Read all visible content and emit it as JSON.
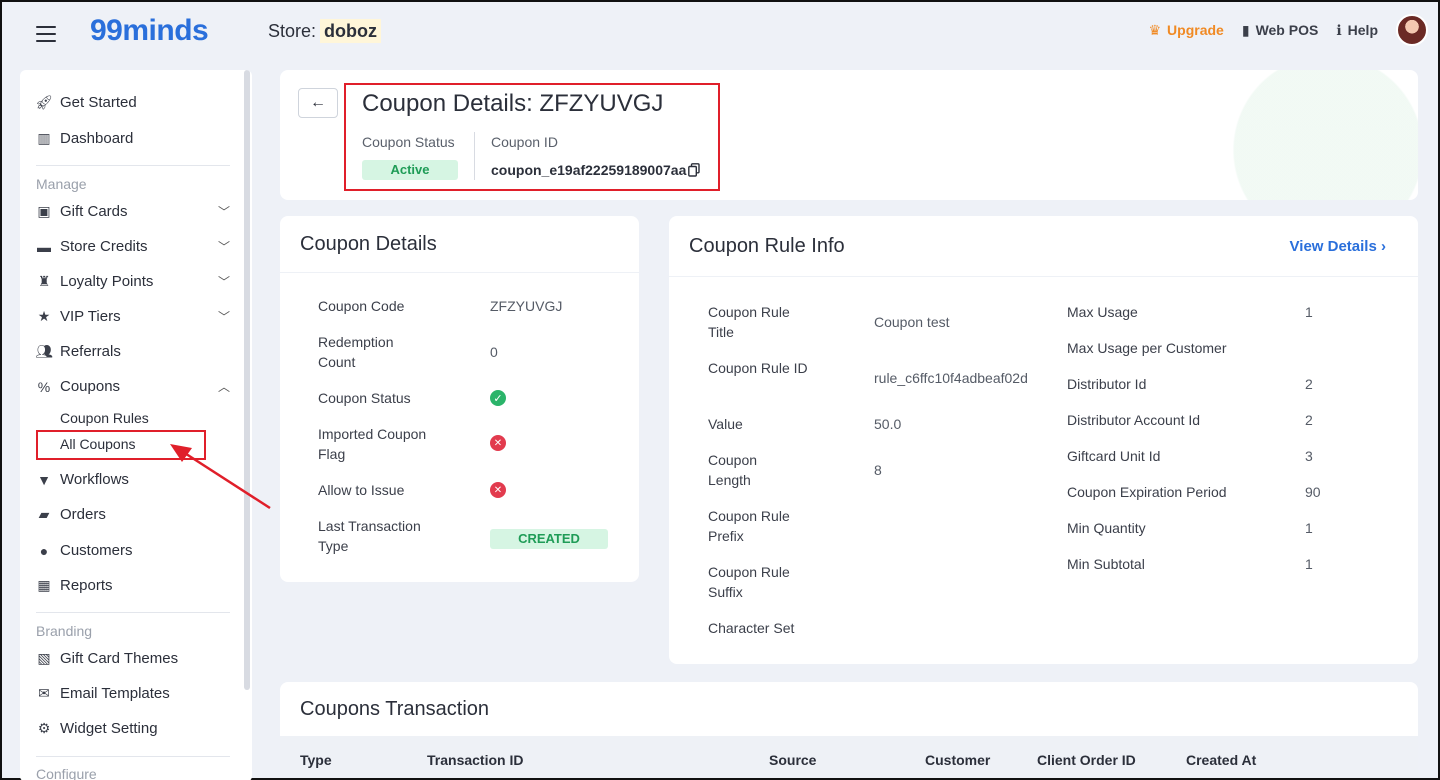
{
  "topbar": {
    "logo": "99minds",
    "store_label": "Store:",
    "store_name": "doboz",
    "upgrade": "Upgrade",
    "web_pos": "Web POS",
    "help": "Help"
  },
  "sidebar": {
    "items_top": [
      {
        "label": "Get Started",
        "icon": "rocket-icon"
      },
      {
        "label": "Dashboard",
        "icon": "chart-icon"
      }
    ],
    "manage_label": "Manage",
    "manage_items": [
      {
        "label": "Gift Cards",
        "icon": "gift-icon"
      },
      {
        "label": "Store Credits",
        "icon": "wallet-icon"
      },
      {
        "label": "Loyalty Points",
        "icon": "trophy-icon"
      },
      {
        "label": "VIP Tiers",
        "icon": "star-icon"
      },
      {
        "label": "Referrals",
        "icon": "users-icon"
      },
      {
        "label": "Coupons",
        "icon": "percent-icon"
      }
    ],
    "coupon_sub": {
      "rules": "Coupon Rules",
      "all": "All Coupons"
    },
    "more_items": [
      {
        "label": "Workflows",
        "icon": "filter-icon"
      },
      {
        "label": "Orders",
        "icon": "bag-icon"
      },
      {
        "label": "Customers",
        "icon": "user-icon"
      },
      {
        "label": "Reports",
        "icon": "table-icon"
      }
    ],
    "branding_label": "Branding",
    "branding_items": [
      {
        "label": "Gift Card Themes",
        "icon": "image-icon"
      },
      {
        "label": "Email Templates",
        "icon": "mail-icon"
      },
      {
        "label": "Widget Setting",
        "icon": "gear-icon"
      }
    ],
    "configure_label": "Configure"
  },
  "header": {
    "title": "Coupon Details: ZFZYUVGJ",
    "status_label": "Coupon Status",
    "status_value": "Active",
    "id_label": "Coupon ID",
    "id_value": "coupon_e19af22259189007aa"
  },
  "details": {
    "title": "Coupon Details",
    "code_label": "Coupon Code",
    "code_value": "ZFZYUVGJ",
    "redemption_label": "Redemption Count",
    "redemption_value": "0",
    "status_label": "Coupon Status",
    "imported_label": "Imported Coupon Flag",
    "allow_label": "Allow to Issue",
    "last_txn_label": "Last Transaction Type",
    "last_txn_value": "CREATED"
  },
  "rule": {
    "title": "Coupon Rule Info",
    "view_details": "View Details",
    "left": [
      {
        "label": "Coupon Rule Title",
        "value": "Coupon test"
      },
      {
        "label": "Coupon Rule ID",
        "value": "rule_c6ffc10f4adbeaf02d"
      },
      {
        "label": "Value",
        "value": "50.0"
      },
      {
        "label": "Coupon Length",
        "value": "8"
      },
      {
        "label": "Coupon Rule Prefix",
        "value": ""
      },
      {
        "label": "Coupon Rule Suffix",
        "value": ""
      },
      {
        "label": "Character Set",
        "value": ""
      }
    ],
    "right": [
      {
        "label": "Max Usage",
        "value": "1"
      },
      {
        "label": "Max Usage per Customer",
        "value": ""
      },
      {
        "label": "Distributor Id",
        "value": "2"
      },
      {
        "label": "Distributor Account Id",
        "value": "2"
      },
      {
        "label": "Giftcard Unit Id",
        "value": "3"
      },
      {
        "label": "Coupon Expiration Period",
        "value": "90"
      },
      {
        "label": "Min Quantity",
        "value": "1"
      },
      {
        "label": "Min Subtotal",
        "value": "1"
      }
    ]
  },
  "transactions": {
    "title": "Coupons Transaction",
    "columns": [
      "Type",
      "Transaction ID",
      "Source",
      "Customer",
      "Client Order ID",
      "Created At"
    ]
  }
}
